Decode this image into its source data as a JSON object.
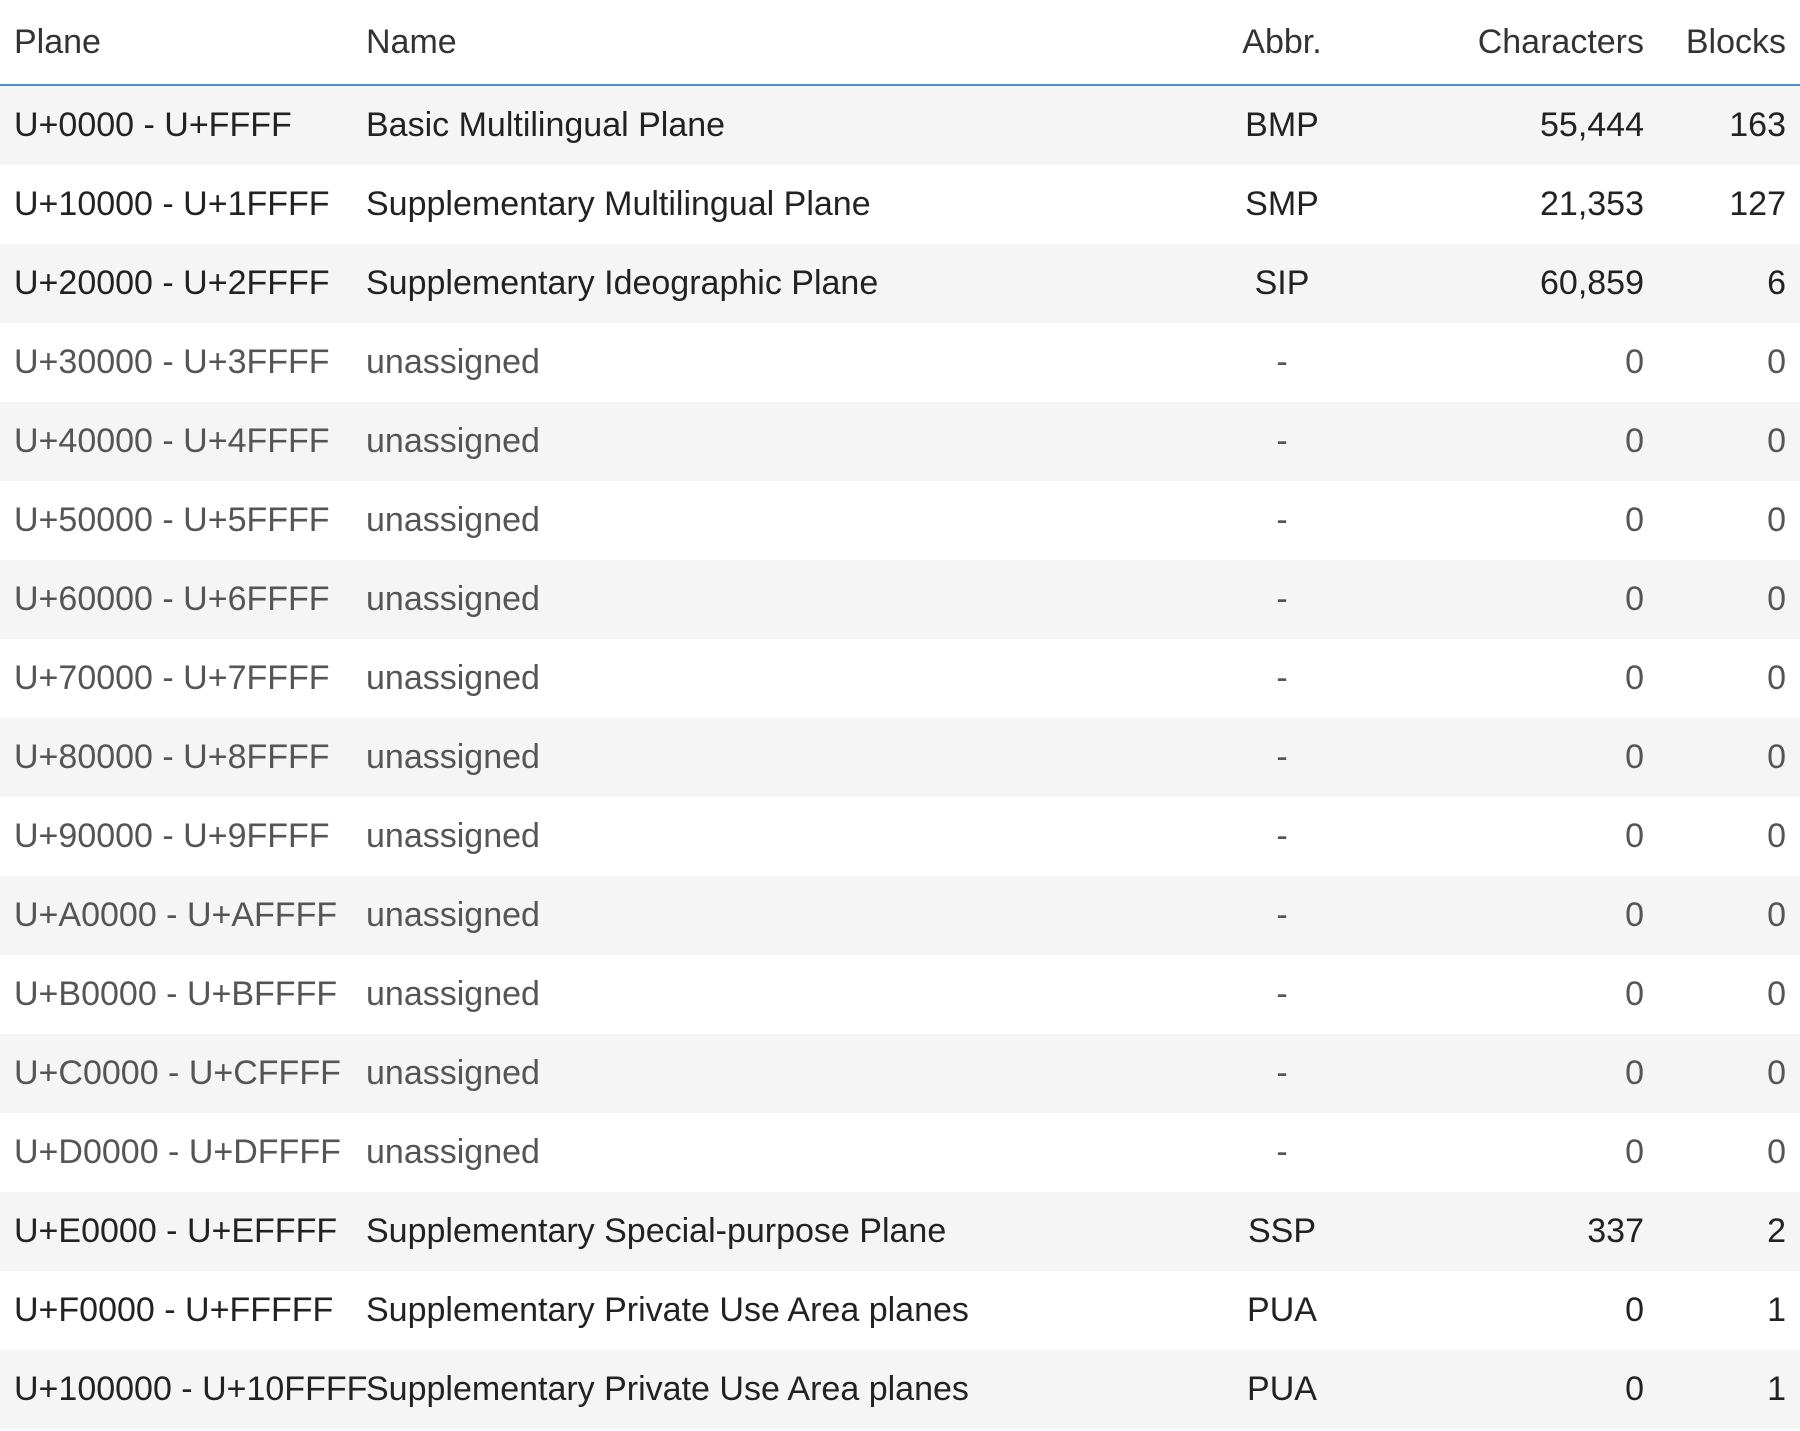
{
  "columns": {
    "plane": "Plane",
    "name": "Name",
    "abbr": "Abbr.",
    "characters": "Characters",
    "blocks": "Blocks"
  },
  "rows": [
    {
      "plane": "U+0000 - U+FFFF",
      "name": "Basic Multilingual Plane",
      "abbr": "BMP",
      "characters": "55,444",
      "blocks": "163"
    },
    {
      "plane": "U+10000 - U+1FFFF",
      "name": "Supplementary Multilingual Plane",
      "abbr": "SMP",
      "characters": "21,353",
      "blocks": "127"
    },
    {
      "plane": "U+20000 - U+2FFFF",
      "name": "Supplementary Ideographic Plane",
      "abbr": "SIP",
      "characters": "60,859",
      "blocks": "6"
    },
    {
      "plane": "U+30000 - U+3FFFF",
      "name": "unassigned",
      "abbr": "-",
      "characters": "0",
      "blocks": "0"
    },
    {
      "plane": "U+40000 - U+4FFFF",
      "name": "unassigned",
      "abbr": "-",
      "characters": "0",
      "blocks": "0"
    },
    {
      "plane": "U+50000 - U+5FFFF",
      "name": "unassigned",
      "abbr": "-",
      "characters": "0",
      "blocks": "0"
    },
    {
      "plane": "U+60000 - U+6FFFF",
      "name": "unassigned",
      "abbr": "-",
      "characters": "0",
      "blocks": "0"
    },
    {
      "plane": "U+70000 - U+7FFFF",
      "name": "unassigned",
      "abbr": "-",
      "characters": "0",
      "blocks": "0"
    },
    {
      "plane": "U+80000 - U+8FFFF",
      "name": "unassigned",
      "abbr": "-",
      "characters": "0",
      "blocks": "0"
    },
    {
      "plane": "U+90000 - U+9FFFF",
      "name": "unassigned",
      "abbr": "-",
      "characters": "0",
      "blocks": "0"
    },
    {
      "plane": "U+A0000 - U+AFFFF",
      "name": "unassigned",
      "abbr": "-",
      "characters": "0",
      "blocks": "0"
    },
    {
      "plane": "U+B0000 - U+BFFFF",
      "name": "unassigned",
      "abbr": "-",
      "characters": "0",
      "blocks": "0"
    },
    {
      "plane": "U+C0000 - U+CFFFF",
      "name": "unassigned",
      "abbr": "-",
      "characters": "0",
      "blocks": "0"
    },
    {
      "plane": "U+D0000 - U+DFFFF",
      "name": "unassigned",
      "abbr": "-",
      "characters": "0",
      "blocks": "0"
    },
    {
      "plane": "U+E0000 - U+EFFFF",
      "name": "Supplementary Special-purpose Plane",
      "abbr": "SSP",
      "characters": "337",
      "blocks": "2"
    },
    {
      "plane": "U+F0000 - U+FFFFF",
      "name": "Supplementary Private Use Area planes",
      "abbr": "PUA",
      "characters": "0",
      "blocks": "1"
    },
    {
      "plane": "U+100000 - U+10FFFF",
      "name": "Supplementary Private Use Area planes",
      "abbr": "PUA",
      "characters": "0",
      "blocks": "1"
    }
  ]
}
